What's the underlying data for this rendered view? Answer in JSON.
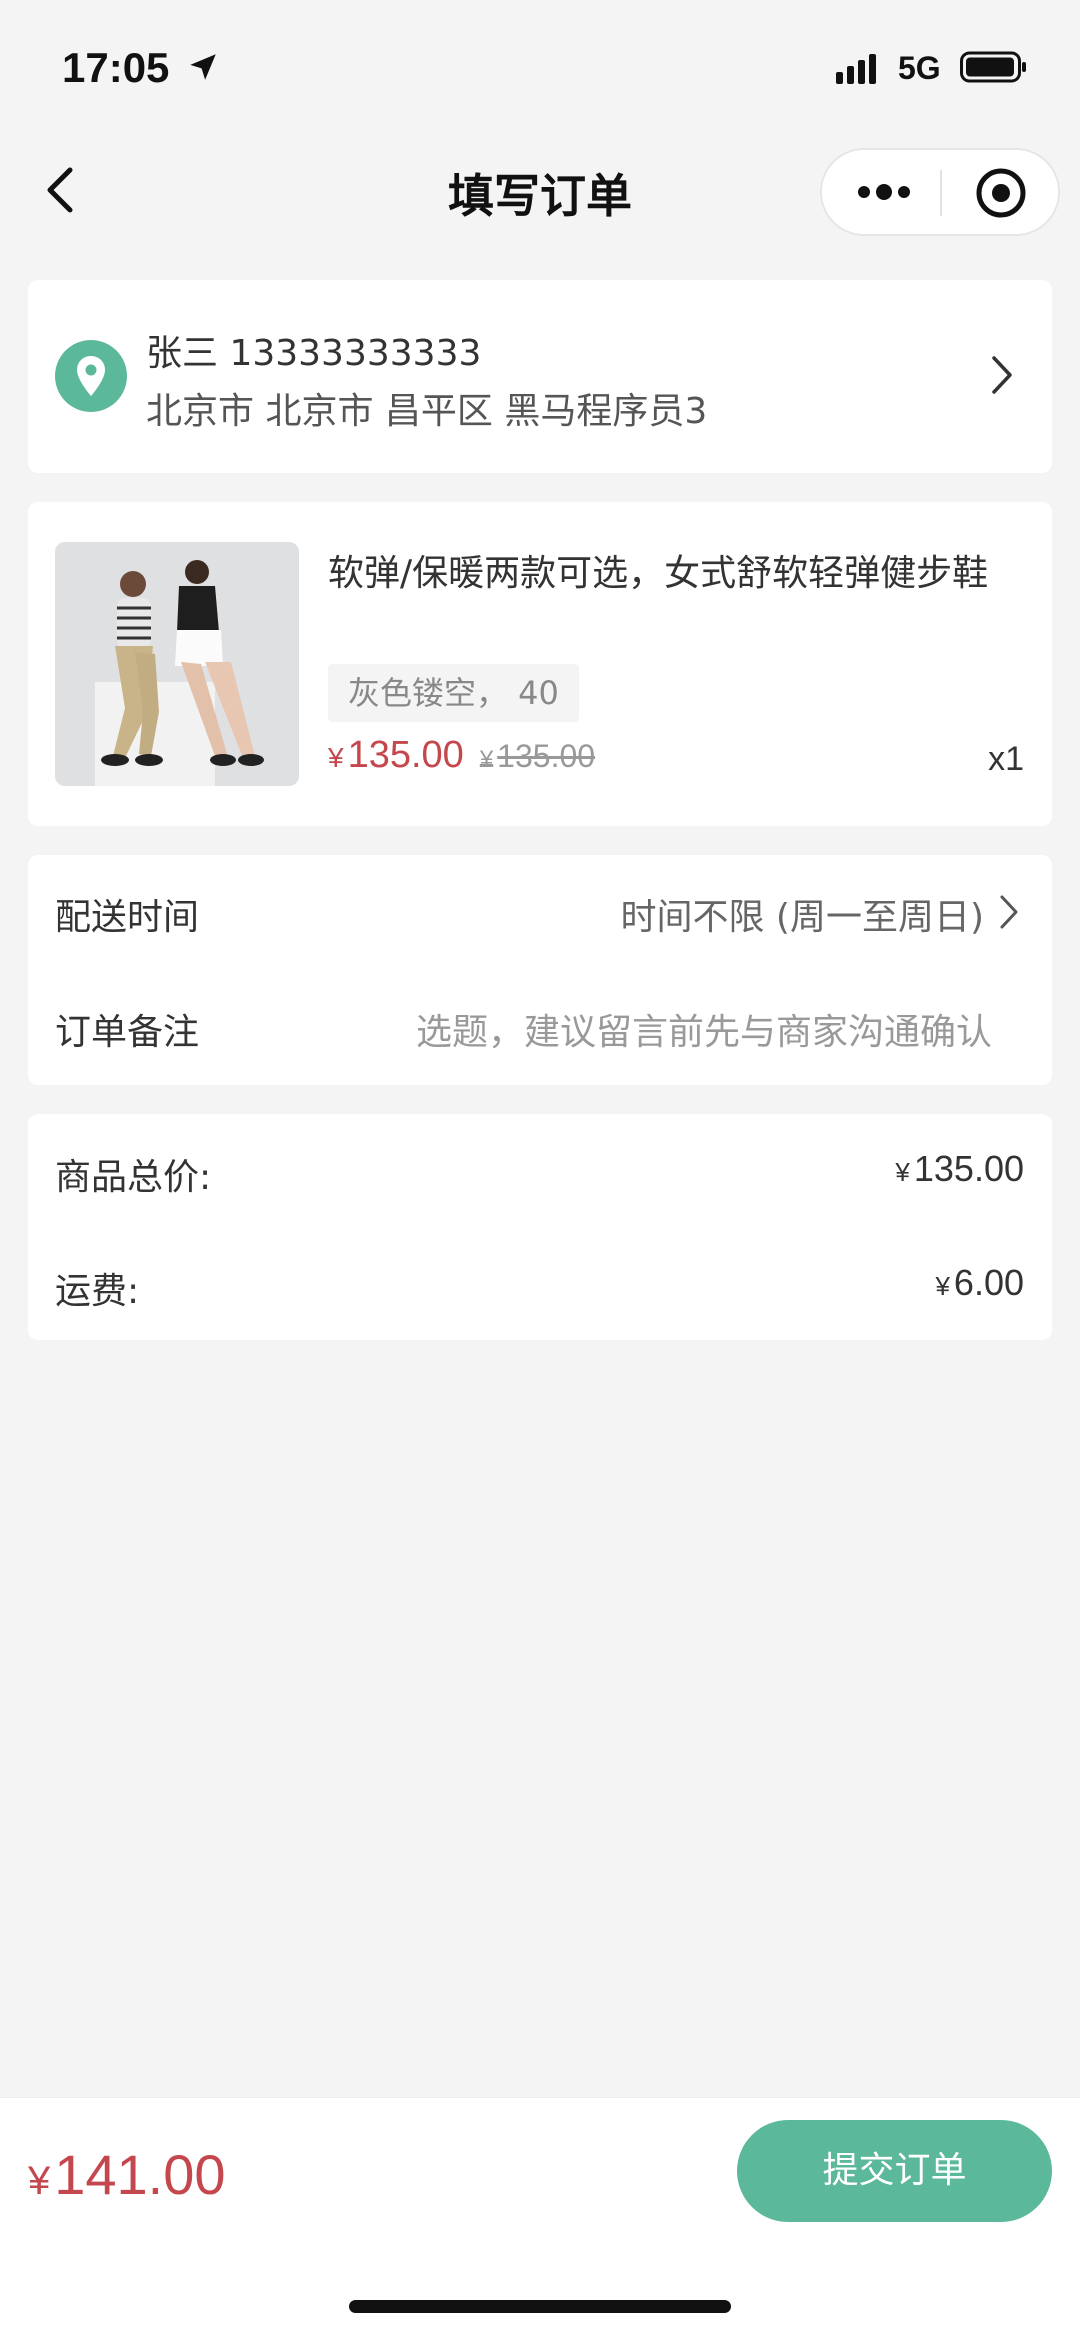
{
  "status_bar": {
    "time": "17:05",
    "network": "5G"
  },
  "nav": {
    "title": "填写订单"
  },
  "address": {
    "name_phone": "张三 13333333333",
    "line": "北京市 北京市 昌平区 黑马程序员3"
  },
  "goods": {
    "title": "软弹/保暖两款可选，女式舒软轻弹健步鞋",
    "sku": "灰色镂空， 40",
    "currency": "¥",
    "price": "135.00",
    "original_price": "135.00",
    "quantity": "x1"
  },
  "options": {
    "delivery_label": "配送时间",
    "delivery_value": "时间不限 (周一至周日)",
    "remark_label": "订单备注",
    "remark_placeholder": "选题，建议留言前先与商家沟通确认"
  },
  "summary": {
    "goods_total_label": "商品总价:",
    "goods_total_value": "135.00",
    "shipping_label": "运费:",
    "shipping_value": "6.00"
  },
  "footer": {
    "total": "141.00",
    "submit_label": "提交订单"
  },
  "colors": {
    "accent": "#5cb89a",
    "price": "#c4474d",
    "background": "#f4f4f4"
  },
  "icons": {
    "location": "location-pin-icon",
    "back": "chevron-left-icon",
    "more": "more-dots-icon",
    "close_target": "target-circle-icon",
    "chevron": "chevron-right-icon"
  }
}
